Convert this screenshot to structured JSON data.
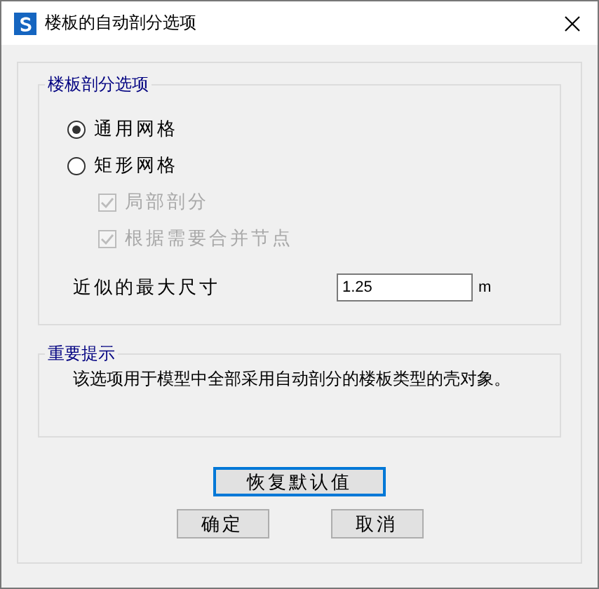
{
  "window": {
    "title": "楼板的自动剖分选项"
  },
  "options": {
    "title": "楼板剖分选项",
    "radios": [
      {
        "label": "通用网格",
        "selected": true
      },
      {
        "label": "矩形网格",
        "selected": false
      }
    ],
    "checkboxes": [
      {
        "label": "局部剖分",
        "checked": true,
        "disabled": true
      },
      {
        "label": "根据需要合并节点",
        "checked": true,
        "disabled": true
      }
    ],
    "size": {
      "label": "近似的最大尺寸",
      "value": "1.25",
      "unit": "m"
    }
  },
  "note": {
    "title": "重要提示",
    "text": "该选项用于模型中全部采用自动剖分的楼板类型的壳对象。"
  },
  "buttons": {
    "restore": {
      "label": "恢复默认值",
      "focused": true
    },
    "actions": [
      {
        "label": "确定",
        "focused": false
      },
      {
        "label": "取消",
        "focused": false
      }
    ]
  }
}
